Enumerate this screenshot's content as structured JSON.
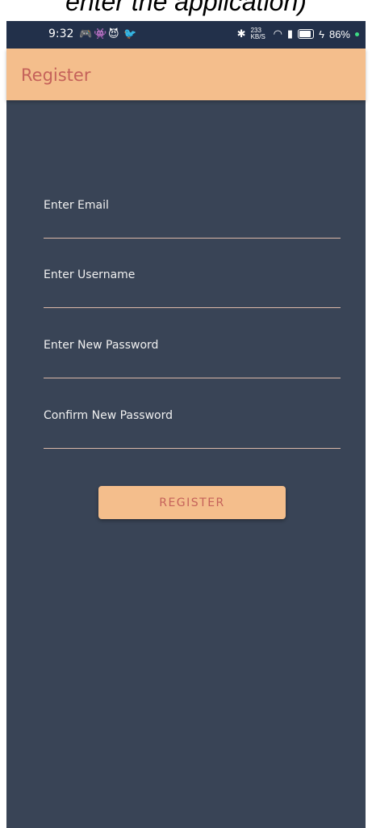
{
  "caption": "enter the application)",
  "status_bar": {
    "time": "9:32",
    "net_speed": "233 KB/S",
    "battery": "86%"
  },
  "app_bar": {
    "title": "Register"
  },
  "form": {
    "email_label": "Enter Email",
    "username_label": "Enter Username",
    "password_label": "Enter New Password",
    "confirm_label": "Confirm New Password",
    "register_button": "REGISTER"
  },
  "colors": {
    "background": "#394456",
    "accent": "#f4be8c",
    "accent_text": "#c5625a",
    "status_bar": "#22304a"
  },
  "icons": [
    "discord-icon",
    "avatar-icon",
    "app-icon",
    "twitter-icon",
    "bluetooth-icon",
    "wifi-icon",
    "signal-icon",
    "battery-icon",
    "charging-icon"
  ]
}
